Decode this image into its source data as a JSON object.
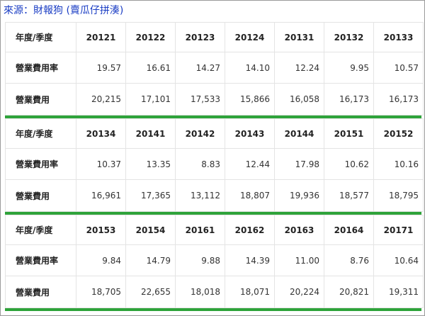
{
  "source_label": "來源：財報狗  (賣瓜仔拼湊)",
  "blocks": [
    {
      "header": [
        "年度/季度",
        "20121",
        "20122",
        "20123",
        "20124",
        "20131",
        "20132",
        "20133"
      ],
      "rows": [
        {
          "label": "營業費用率",
          "values": [
            "19.57",
            "16.61",
            "14.27",
            "14.10",
            "12.24",
            "9.95",
            "10.57"
          ]
        },
        {
          "label": "營業費用",
          "values": [
            "20,215",
            "17,101",
            "17,533",
            "15,866",
            "16,058",
            "16,173",
            "16,173"
          ]
        }
      ]
    },
    {
      "header": [
        "年度/季度",
        "20134",
        "20141",
        "20142",
        "20143",
        "20144",
        "20151",
        "20152"
      ],
      "rows": [
        {
          "label": "營業費用率",
          "values": [
            "10.37",
            "13.35",
            "8.83",
            "12.44",
            "17.98",
            "10.62",
            "10.16"
          ]
        },
        {
          "label": "營業費用",
          "values": [
            "16,961",
            "17,365",
            "13,112",
            "18,807",
            "19,936",
            "18,577",
            "18,795"
          ]
        }
      ]
    },
    {
      "header": [
        "年度/季度",
        "20153",
        "20154",
        "20161",
        "20162",
        "20163",
        "20164",
        "20171"
      ],
      "rows": [
        {
          "label": "營業費用率",
          "values": [
            "9.84",
            "14.79",
            "9.88",
            "14.39",
            "11.00",
            "8.76",
            "10.64"
          ]
        },
        {
          "label": "營業費用",
          "values": [
            "18,705",
            "22,655",
            "18,018",
            "18,071",
            "20,224",
            "20,821",
            "19,311"
          ]
        }
      ]
    }
  ],
  "colors": {
    "source_text": "#1a3dc4",
    "divider": "#2ea33a",
    "grid": "#e4e4e4"
  }
}
